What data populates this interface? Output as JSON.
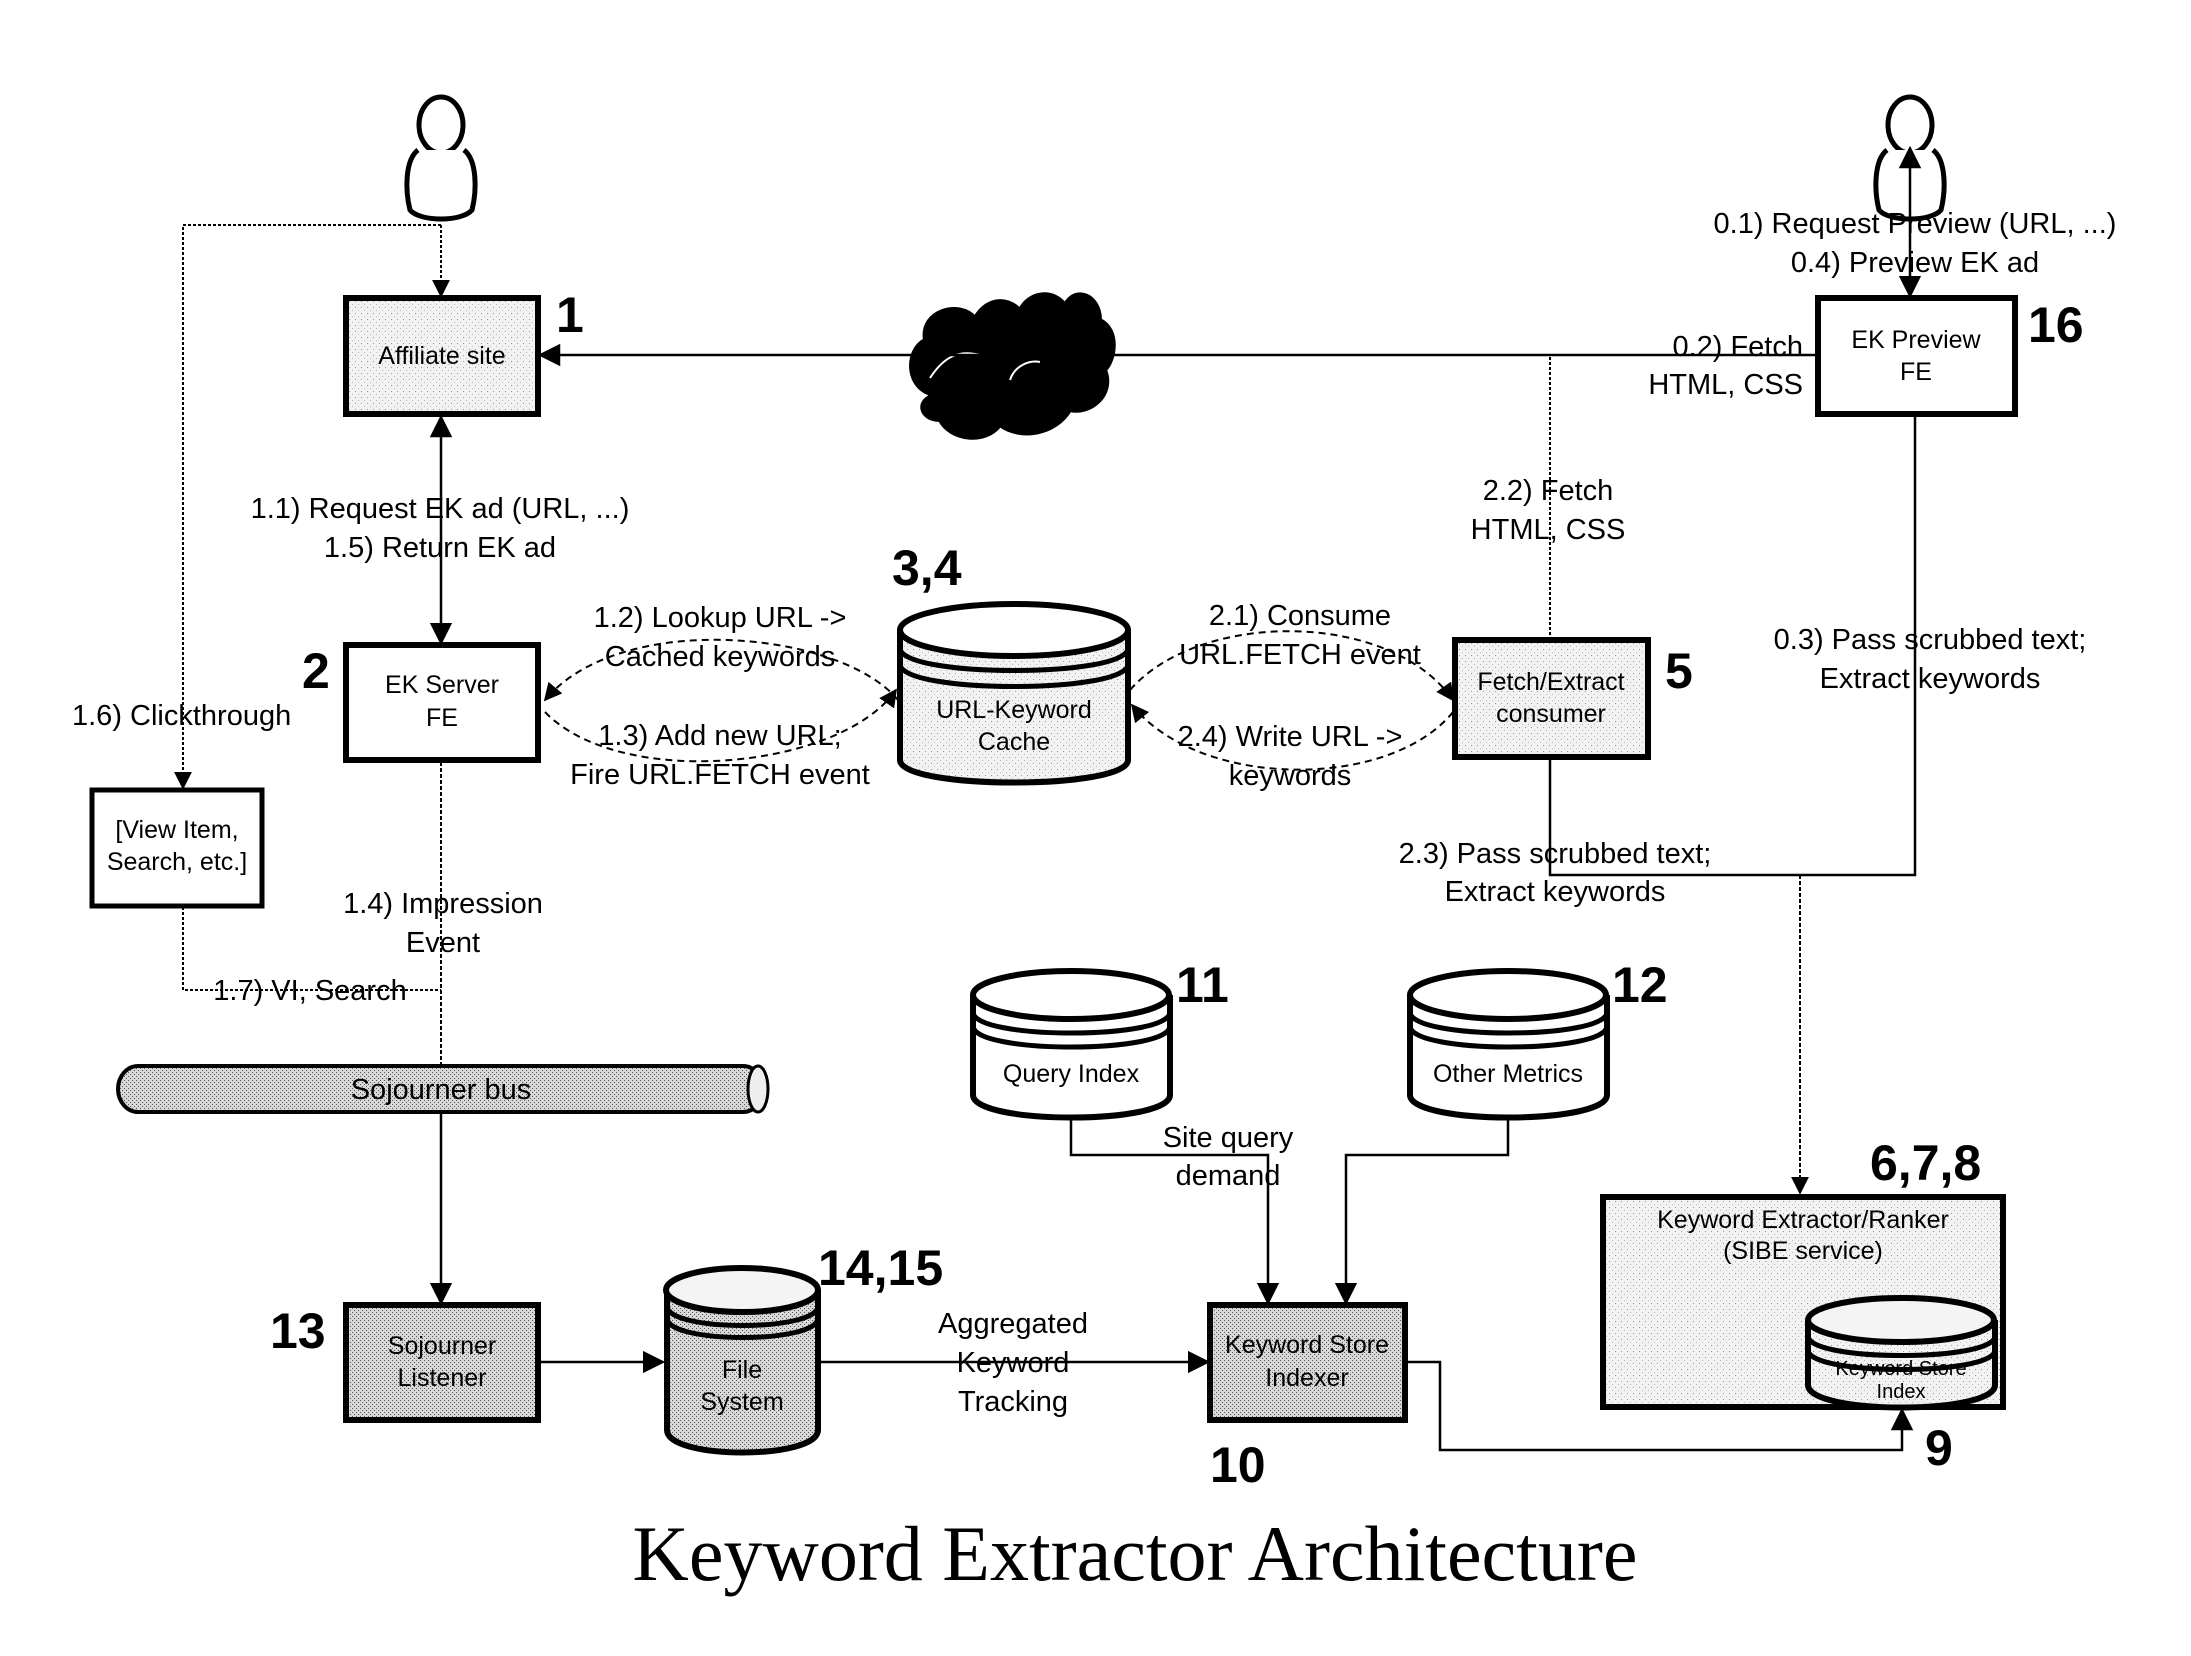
{
  "title": "Keyword Extractor Architecture",
  "nodes": {
    "affiliate_site": {
      "label": "Affiliate site",
      "number": "1"
    },
    "ek_server_fe": {
      "line1": "EK Server",
      "line2": "FE",
      "number": "2"
    },
    "url_keyword_cache": {
      "line1": "URL-Keyword",
      "line2": "Cache",
      "number": "3,4"
    },
    "fetch_extract": {
      "line1": "Fetch/Extract",
      "line2": "consumer",
      "number": "5"
    },
    "keyword_extractor": {
      "line1": "Keyword Extractor/Ranker",
      "line2": "(SIBE service)",
      "number": "6,7,8"
    },
    "keyword_store_index": {
      "line1": "Keyword Store",
      "line2": "Index",
      "number": "9"
    },
    "keyword_store_indexer": {
      "line1": "Keyword Store",
      "line2": "Indexer",
      "number": "10"
    },
    "query_index": {
      "label": "Query Index",
      "number": "11"
    },
    "other_metrics": {
      "label": "Other Metrics",
      "number": "12"
    },
    "sojourner_listener": {
      "line1": "Sojourner",
      "line2": "Listener",
      "number": "13"
    },
    "file_system": {
      "line1": "File",
      "line2": "System",
      "number": "14,15"
    },
    "ek_preview_fe": {
      "line1": "EK Preview",
      "line2": "FE",
      "number": "16"
    },
    "view_item": {
      "line1": "[View Item,",
      "line2": "Search, etc.]"
    },
    "sojourner_bus": {
      "label": "Sojourner bus"
    }
  },
  "edges": {
    "e0_1": "0.1) Request Preview (URL, ...)",
    "e0_4": "0.4) Preview EK ad",
    "e0_2a": "0.2) Fetch",
    "e0_2b": "HTML, CSS",
    "e0_3a": "0.3) Pass scrubbed text;",
    "e0_3b": "Extract keywords",
    "e1_1": "1.1) Request EK ad (URL, ...)",
    "e1_5": "1.5) Return EK ad",
    "e1_2a": "1.2) Lookup URL ->",
    "e1_2b": "Cached keywords",
    "e1_3a": "1.3) Add new URL;",
    "e1_3b": "Fire URL.FETCH event",
    "e1_4a": "1.4) Impression",
    "e1_4b": "Event",
    "e1_6": "1.6) Clickthrough",
    "e1_7": "1.7) VI, Search",
    "e2_1a": "2.1) Consume",
    "e2_1b": "URL.FETCH event",
    "e2_2a": "2.2) Fetch",
    "e2_2b": "HTML, CSS",
    "e2_3a": "2.3) Pass scrubbed text;",
    "e2_3b": "Extract keywords",
    "e2_4a": "2.4) Write URL ->",
    "e2_4b": "keywords",
    "site_query_a": "Site query",
    "site_query_b": "demand",
    "agg_a": "Aggregated",
    "agg_b": "Keyword",
    "agg_c": "Tracking"
  }
}
